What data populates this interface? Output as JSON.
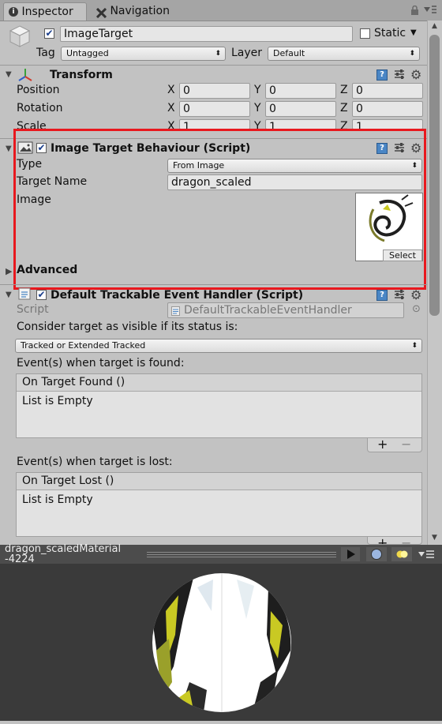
{
  "tabs": [
    {
      "label": "Inspector",
      "icon": "info-icon"
    },
    {
      "label": "Navigation",
      "icon": "navigation-icon"
    }
  ],
  "gameobject": {
    "name": "ImageTarget",
    "static_label": "Static",
    "tag_label": "Tag",
    "tag_value": "Untagged",
    "layer_label": "Layer",
    "layer_value": "Default"
  },
  "transform": {
    "title": "Transform",
    "rows": [
      {
        "label": "Position",
        "x": "0",
        "y": "0",
        "z": "0"
      },
      {
        "label": "Rotation",
        "x": "0",
        "y": "0",
        "z": "0"
      },
      {
        "label": "Scale",
        "x": "1",
        "y": "1",
        "z": "1"
      }
    ],
    "axis_x": "X",
    "axis_y": "Y",
    "axis_z": "Z"
  },
  "image_target": {
    "title": "Image Target Behaviour (Script)",
    "type_label": "Type",
    "type_value": "From Image",
    "target_name_label": "Target Name",
    "target_name_value": "dragon_scaled",
    "image_label": "Image",
    "select_label": "Select",
    "advanced_label": "Advanced"
  },
  "event_handler": {
    "title": "Default Trackable Event Handler (Script)",
    "script_label": "Script",
    "script_value": "DefaultTrackableEventHandler",
    "consider_label": "Consider target as visible if its status is:",
    "status_value": "Tracked or Extended Tracked",
    "found_label": "Event(s) when target is found:",
    "found_list_title": "On Target Found ()",
    "found_empty": "List is Empty",
    "lost_label": "Event(s) when target is lost:",
    "lost_list_title": "On Target Lost ()",
    "lost_empty": "List is Empty",
    "plus": "+",
    "minus": "−"
  },
  "preview": {
    "material_name_line1": "dragon_scaledMaterial",
    "material_name_line2": "-4224"
  },
  "colors": {
    "highlight_box": "#e8181e",
    "check_blue": "#1a3e8c"
  }
}
